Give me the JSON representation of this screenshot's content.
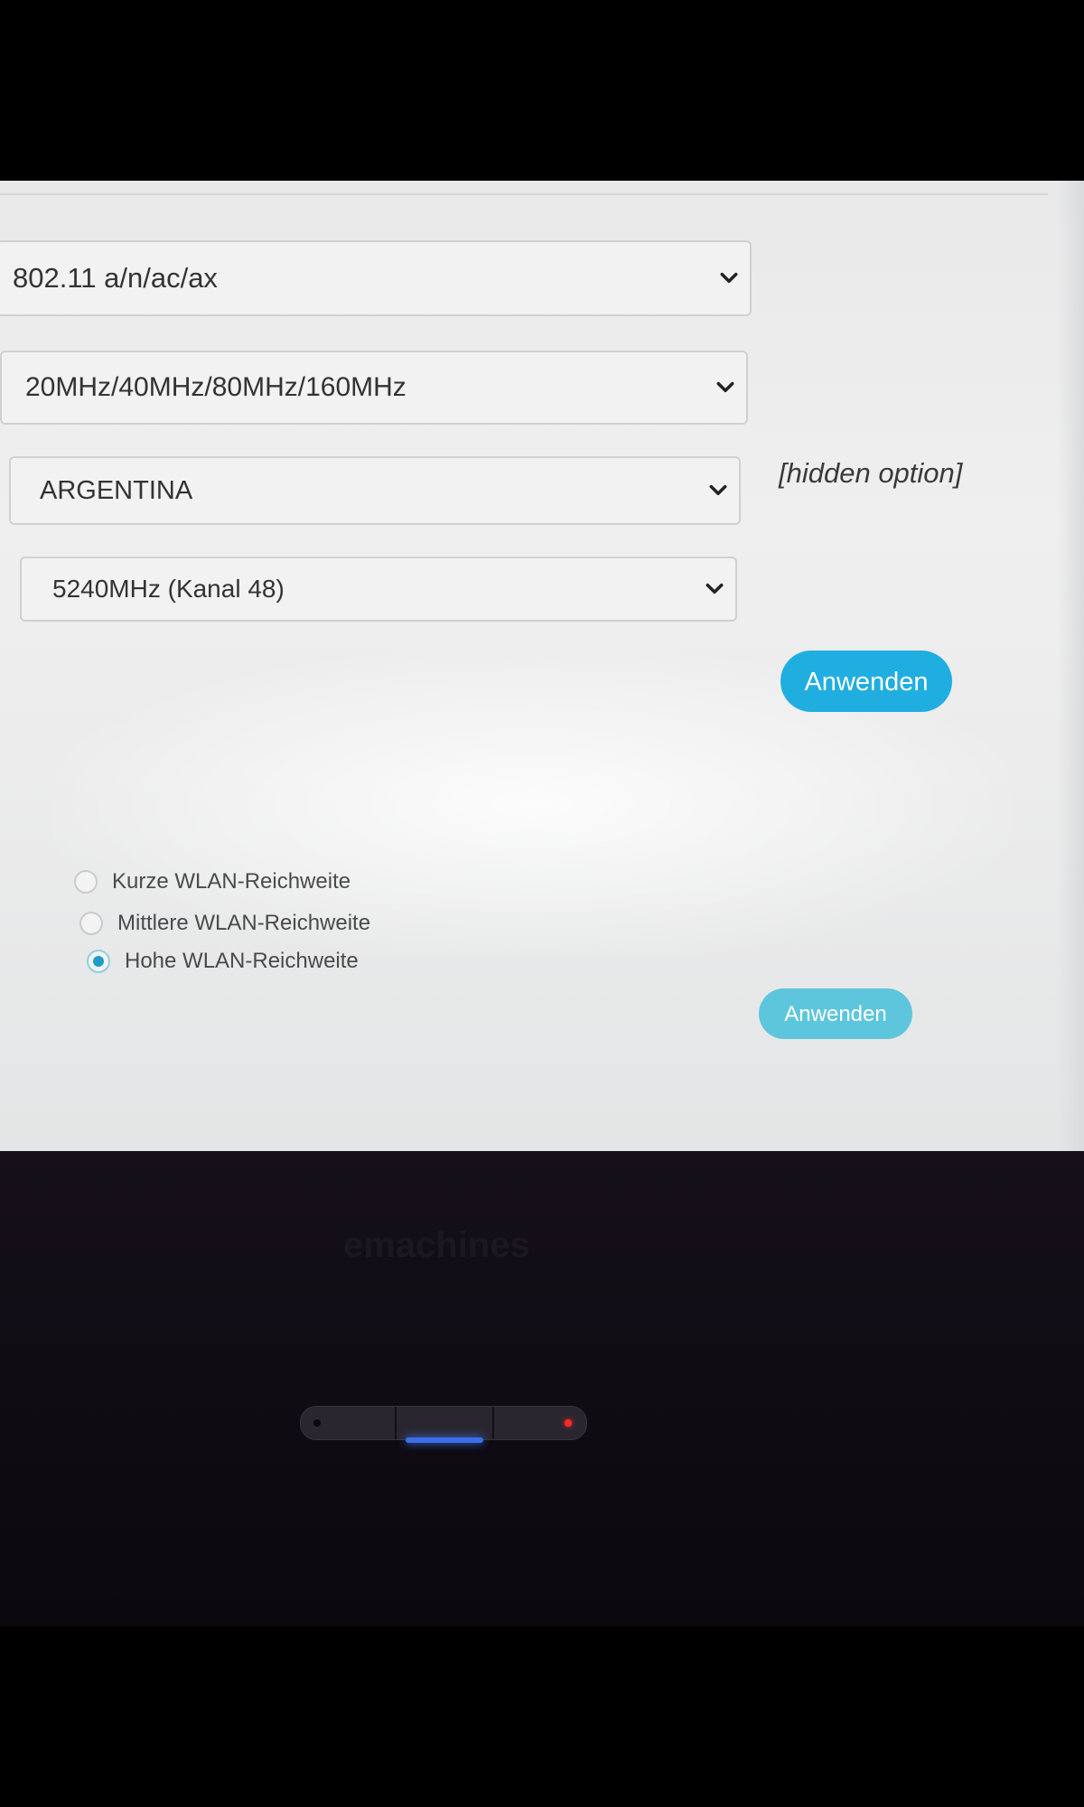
{
  "wlan_settings": {
    "mode_select": {
      "value": "802.11 a/n/ac/ax"
    },
    "bandwidth_select": {
      "value": "20MHz/40MHz/80MHz/160MHz"
    },
    "country_select": {
      "value": "ARGENTINA"
    },
    "hidden_option_label": "[hidden option]",
    "channel_select": {
      "value": "5240MHz (Kanal 48)"
    },
    "apply_button_label": "Anwenden"
  },
  "wlan_range": {
    "options": [
      {
        "label": "Kurze WLAN-Reichweite",
        "checked": false
      },
      {
        "label": "Mittlere WLAN-Reichweite",
        "checked": false
      },
      {
        "label": "Hohe WLAN-Reichweite",
        "checked": true
      }
    ],
    "apply_button_label": "Anwenden"
  },
  "laptop": {
    "brand": "emachines"
  },
  "colors": {
    "accent": "#20aee0",
    "accent_muted": "#5ec6dc",
    "radio_checked": "#1aa0c8",
    "power_led": "#3b6fe8",
    "status_led": "#ff2a2a"
  },
  "icons": {
    "select_arrow": "chevron-down-icon"
  }
}
